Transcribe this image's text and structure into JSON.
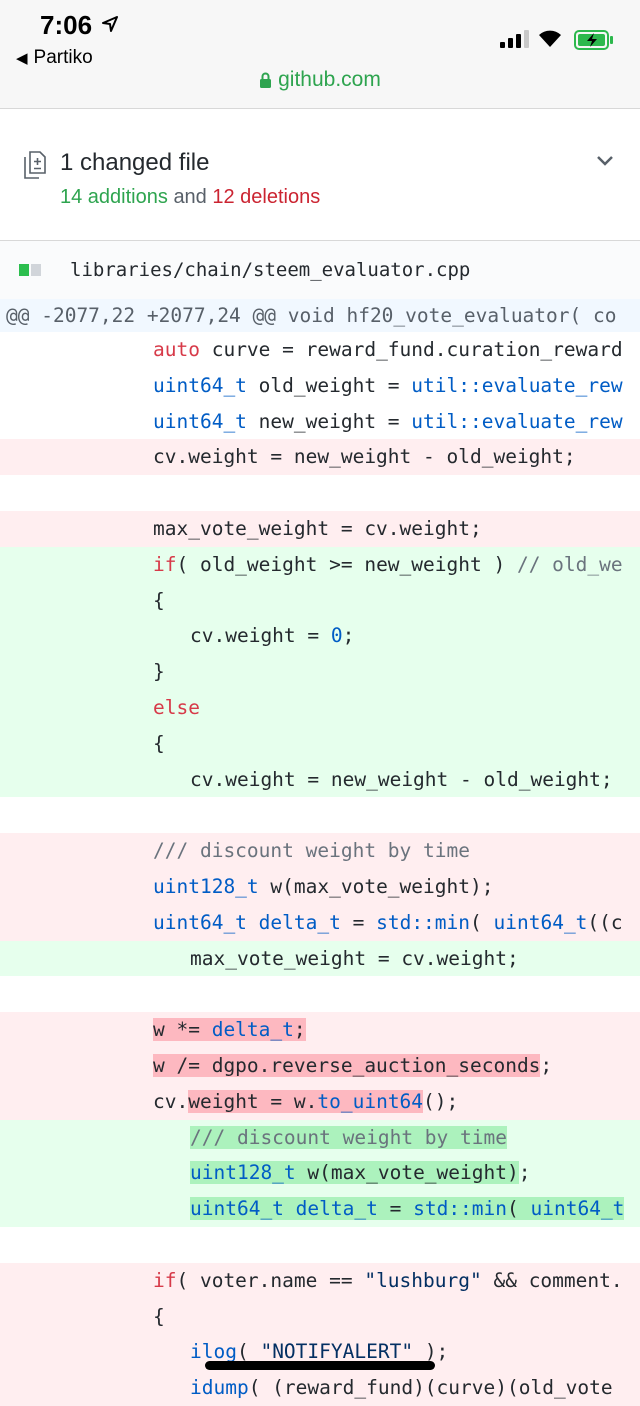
{
  "status": {
    "time": "7:06",
    "back_label": "Partiko",
    "url": "github.com"
  },
  "summary": {
    "title": "1 changed file",
    "additions": "14 additions",
    "and": "and",
    "deletions": "12 deletions"
  },
  "file": {
    "name": "libraries/chain/steem_evaluator.cpp"
  },
  "colors": {
    "add_text": "#2ea44f",
    "del_text": "#cb2431",
    "add_bg": "#e6ffed",
    "del_bg": "#ffeef0"
  },
  "diff": {
    "hunk": "@@ -2077,22 +2077,24 @@ void hf20_vote_evaluator( co",
    "lines": [
      {
        "type": "ctx",
        "segments": [
          {
            "t": "auto",
            "c": "kw"
          },
          {
            "t": " curve = reward_fund.curation_reward"
          }
        ]
      },
      {
        "type": "ctx",
        "segments": [
          {
            "t": "uint64_t",
            "c": "fn"
          },
          {
            "t": " old_weight = "
          },
          {
            "t": "util::evaluate_rew",
            "c": "fn"
          }
        ]
      },
      {
        "type": "ctx",
        "segments": [
          {
            "t": "uint64_t",
            "c": "fn"
          },
          {
            "t": " new_weight = "
          },
          {
            "t": "util::evaluate_rew",
            "c": "fn"
          }
        ]
      },
      {
        "type": "del",
        "segments": [
          {
            "t": "cv.weight = new_weight - old_weight;"
          }
        ]
      },
      {
        "type": "ctx",
        "segments": []
      },
      {
        "type": "del",
        "segments": [
          {
            "t": "max_vote_weight = cv.weight;"
          }
        ]
      },
      {
        "type": "add",
        "segments": [
          {
            "t": "if",
            "c": "kw"
          },
          {
            "t": "( old_weight >= new_weight ) "
          },
          {
            "t": "// old_we",
            "c": "cm"
          }
        ]
      },
      {
        "type": "add",
        "segments": [
          {
            "t": "{"
          }
        ]
      },
      {
        "type": "add",
        "indent": true,
        "segments": [
          {
            "t": "cv.weight = "
          },
          {
            "t": "0",
            "c": "fn"
          },
          {
            "t": ";"
          }
        ]
      },
      {
        "type": "add",
        "segments": [
          {
            "t": "}"
          }
        ]
      },
      {
        "type": "add",
        "segments": [
          {
            "t": "else",
            "c": "kw"
          }
        ]
      },
      {
        "type": "add",
        "segments": [
          {
            "t": "{"
          }
        ]
      },
      {
        "type": "add",
        "indent": true,
        "segments": [
          {
            "t": "cv.weight = new_weight - old_weight;"
          }
        ]
      },
      {
        "type": "ctx",
        "segments": []
      },
      {
        "type": "del",
        "segments": [
          {
            "t": "/// discount weight by time",
            "c": "cm"
          }
        ]
      },
      {
        "type": "del",
        "segments": [
          {
            "t": "uint128_t",
            "c": "fn"
          },
          {
            "t": " w(max_vote_weight);"
          }
        ]
      },
      {
        "type": "del",
        "segments": [
          {
            "t": "uint64_t",
            "c": "fn"
          },
          {
            "t": " "
          },
          {
            "t": "delta_t",
            "c": "fn"
          },
          {
            "t": " = "
          },
          {
            "t": "std::min",
            "c": "fn"
          },
          {
            "t": "( "
          },
          {
            "t": "uint64_t",
            "c": "fn"
          },
          {
            "t": "((c"
          }
        ]
      },
      {
        "type": "add",
        "indent": true,
        "segments": [
          {
            "t": "max_vote_weight = cv.weight;"
          }
        ]
      },
      {
        "type": "ctx",
        "segments": []
      },
      {
        "type": "del",
        "segments": [
          {
            "t": "w *= ",
            "x": true
          },
          {
            "t": "delta_t",
            "c": "fn",
            "x": true
          },
          {
            "t": ";",
            "x": true
          }
        ]
      },
      {
        "type": "del",
        "segments": [
          {
            "t": "w /= dgpo.reverse_auction_seconds",
            "x": true
          },
          {
            "t": ";"
          }
        ]
      },
      {
        "type": "del",
        "segments": [
          {
            "t": "cv."
          },
          {
            "t": "weight = w.",
            "x": true
          },
          {
            "t": "to_uint64",
            "c": "fn",
            "x": true
          },
          {
            "t": "();"
          }
        ]
      },
      {
        "type": "add",
        "indent": true,
        "segments": [
          {
            "t": "/// discount weight by time",
            "c": "cm",
            "x": true
          }
        ]
      },
      {
        "type": "add",
        "indent": true,
        "segments": [
          {
            "t": "uint128_t",
            "c": "fn",
            "x": true
          },
          {
            "t": " w(max_vote_weight)",
            "x": true
          },
          {
            "t": ";"
          }
        ]
      },
      {
        "type": "add",
        "indent": true,
        "segments": [
          {
            "t": "uint64_t",
            "c": "fn",
            "x": true
          },
          {
            "t": " ",
            "x": true
          },
          {
            "t": "delta_t",
            "c": "fn",
            "x": true
          },
          {
            "t": " = ",
            "x": true
          },
          {
            "t": "std::min",
            "c": "fn",
            "x": true
          },
          {
            "t": "( ",
            "x": true
          },
          {
            "t": "uint64_t",
            "c": "fn",
            "x": true
          }
        ]
      },
      {
        "type": "ctx",
        "segments": []
      },
      {
        "type": "del",
        "segments": [
          {
            "t": "if",
            "c": "kw"
          },
          {
            "t": "( voter.name == "
          },
          {
            "t": "\"lushburg\"",
            "c": "st"
          },
          {
            "t": " && comment."
          }
        ]
      },
      {
        "type": "del",
        "segments": [
          {
            "t": "{"
          }
        ]
      },
      {
        "type": "del",
        "indent": true,
        "segments": [
          {
            "t": "ilog",
            "c": "fn"
          },
          {
            "t": "( "
          },
          {
            "t": "\"NOTIFYALERT\"",
            "c": "st"
          },
          {
            "t": " );"
          }
        ]
      },
      {
        "type": "del",
        "indent": true,
        "segments": [
          {
            "t": "idump",
            "c": "fn"
          },
          {
            "t": "( (reward_fund)(curve)(old_vote"
          }
        ]
      }
    ]
  }
}
